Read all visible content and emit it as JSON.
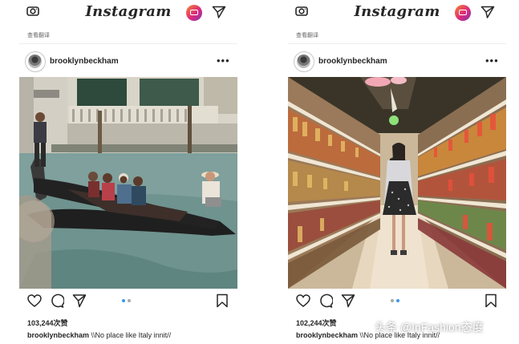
{
  "posts": [
    {
      "header": {
        "logo_text": "Instagram"
      },
      "see_translation": "查看翻译",
      "username": "brooklynbeckham",
      "more": "•••",
      "photo_name": "gondola-photo",
      "likes": "103,244次赞",
      "caption_user": "brooklynbeckham",
      "caption_text": "\\\\No place like Italy innit//",
      "carousel": {
        "count": 2,
        "active": 0
      }
    },
    {
      "header": {
        "logo_text": "Instagram"
      },
      "see_translation": "查看翻译",
      "username": "brooklynbeckham",
      "more": "•••",
      "photo_name": "supermarket-photo",
      "likes": "102,244次赞",
      "caption_user": "brooklynbeckham",
      "caption_text": "\\\\No place like Italy innit//",
      "carousel": {
        "count": 2,
        "active": 1
      }
    }
  ],
  "watermark": "头条 @InFashion态度",
  "colors": {
    "ig_gradient_start": "#f58529",
    "ig_gradient_mid": "#dd2a7b",
    "ig_gradient_end": "#8134af",
    "dot_active": "#3897f0",
    "dot_inactive": "#a8a8a8"
  }
}
